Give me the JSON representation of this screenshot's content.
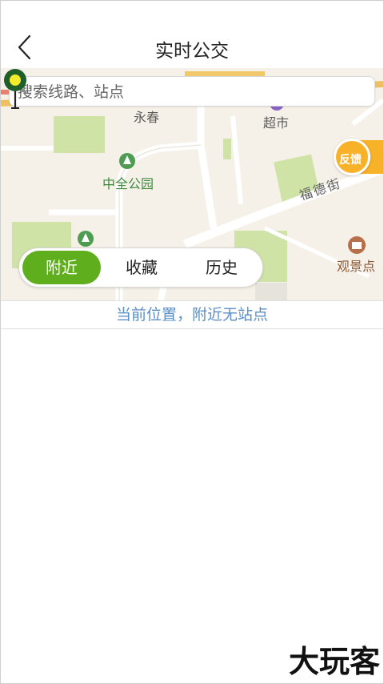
{
  "header": {
    "title": "实时公交"
  },
  "search": {
    "placeholder": "搜索线路、站点"
  },
  "map": {
    "pois": {
      "yongchun": "永春",
      "chaoshi": "超市",
      "zhongquan_park": "中全公园",
      "fude_street": "福德街",
      "scenic_spot": "观景点"
    },
    "feedback_label": "反馈"
  },
  "tabs": [
    {
      "label": "附近",
      "active": true
    },
    {
      "label": "收藏",
      "active": false
    },
    {
      "label": "历史",
      "active": false
    }
  ],
  "status": {
    "message": "当前位置，附近无站点"
  },
  "watermark": {
    "text": "大玩客"
  },
  "colors": {
    "accent_green": "#5fae1d",
    "status_blue": "#5b8fc6",
    "feedback_orange": "#f7b22a"
  }
}
